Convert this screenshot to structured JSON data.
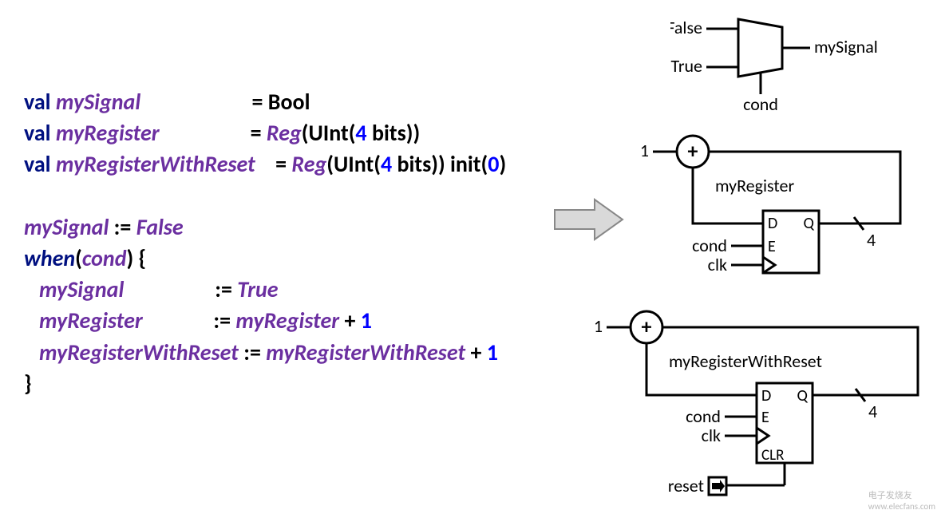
{
  "code": {
    "l1_val": "val",
    "l1_id": "mySignal",
    "l1_eq": "=",
    "l1_type": "Bool",
    "l2_val": "val",
    "l2_id": "myRegister",
    "l2_eq": "=",
    "l2_reg": "Reg",
    "l2_open": "(UInt(",
    "l2_num": "4",
    "l2_close": " bits))",
    "l3_val": "val",
    "l3_id": "myRegisterWithReset",
    "l3_eq": "=",
    "l3_reg": "Reg",
    "l3_open": "(UInt(",
    "l3_num": "4",
    "l3_close": " bits)) init(",
    "l3_init": "0",
    "l3_end": ")",
    "l5_id": "mySignal",
    "l5_op": ":=",
    "l5_val": "False",
    "l6_when": "when",
    "l6_open": "(",
    "l6_cond": "cond",
    "l6_close": ") {",
    "l7_id": "mySignal",
    "l7_op": ":=",
    "l7_val": "True",
    "l8_id": "myRegister",
    "l8_op": ":=",
    "l8_rhs": "myRegister",
    "l8_plus": "+",
    "l8_num": "1",
    "l9_id": "myRegisterWithReset",
    "l9_op": ":=",
    "l9_rhs": "myRegisterWithReset",
    "l9_plus": "+",
    "l9_num": "1",
    "l10_brace": "}"
  },
  "diagram1": {
    "in_false": "False",
    "in_true": "True",
    "out": "mySignal",
    "sel": "cond"
  },
  "diagram2": {
    "one": "1",
    "label": "myRegister",
    "D": "D",
    "Q": "Q",
    "E": "E",
    "cond": "cond",
    "clk": "clk",
    "width": "4"
  },
  "diagram3": {
    "one": "1",
    "label": "myRegisterWithReset",
    "D": "D",
    "Q": "Q",
    "E": "E",
    "CLR": "CLR",
    "cond": "cond",
    "clk": "clk",
    "reset": "reset",
    "width": "4"
  },
  "watermark": {
    "line1": "电子发烧友",
    "line2": "www.elecfans.com"
  }
}
